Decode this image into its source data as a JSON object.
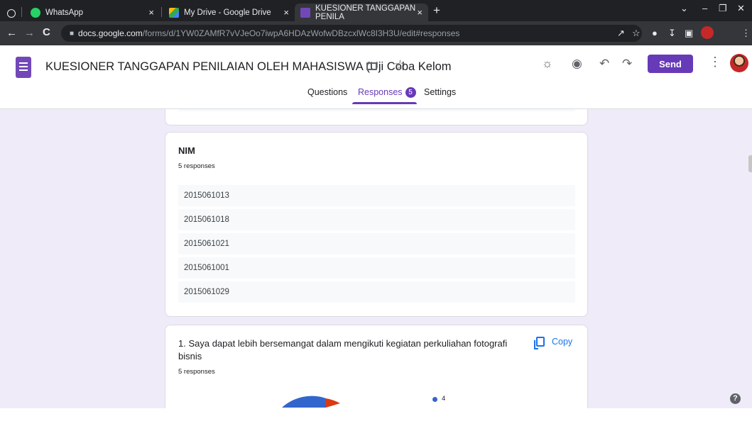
{
  "browser": {
    "tabs": [
      {
        "title": "WhatsApp",
        "close": "×"
      },
      {
        "title": "My Drive - Google Drive",
        "close": "×"
      },
      {
        "title": "KUESIONER TANGGAPAN PENILA",
        "close": "×"
      }
    ],
    "new_tab": "+",
    "address": {
      "domain": "docs.google.com",
      "path": "/forms/d/1YW0ZAMfR7vVJeOo7iwpA6HDAzWofwDBzcxlWc8I3H3U/edit#responses"
    }
  },
  "form": {
    "title": "KUESIONER TANGGAPAN PENILAIAN OLEH MAHASISWA (Uji Coba Kelom",
    "send_label": "Send",
    "tabs": {
      "questions": "Questions",
      "responses": "Responses",
      "settings": "Settings"
    },
    "responses_count": "5"
  },
  "nim_card": {
    "title": "NIM",
    "count": "5 responses",
    "responses": [
      "2015061013",
      "2015061018",
      "2015061021",
      "2015061001",
      "2015061029"
    ]
  },
  "q1_card": {
    "title_line1": "1. Saya dapat lebih bersemangat dalam mengikuti kegiatan perkuliahan fotografi",
    "title_line2": "bisnis",
    "count": "5 responses",
    "copy_label": "Copy",
    "legend_value": "4"
  },
  "colors": {
    "accent": "#673ab7",
    "link": "#1a73e8",
    "background": "#f0ebf8"
  }
}
